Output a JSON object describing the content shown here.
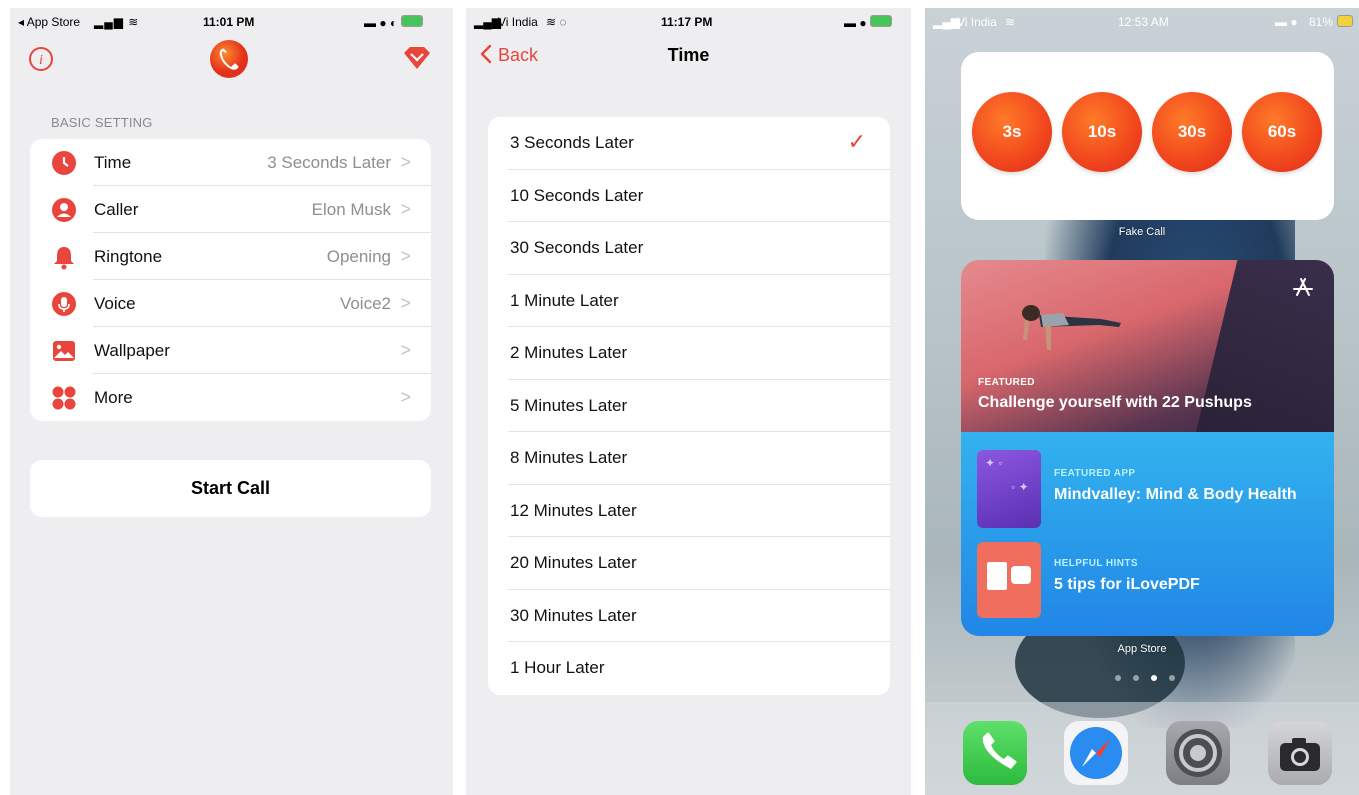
{
  "screen1": {
    "status": {
      "carrier": "◂ App Store",
      "time": "11:01 PM"
    },
    "header": {
      "info_icon": "info-icon",
      "logo_icon": "phone-icon",
      "premium_icon": "gem-icon"
    },
    "section_label": "BASIC SETTING",
    "settings": [
      {
        "label": "Time",
        "value": "3 Seconds Later",
        "icon": "clock-icon"
      },
      {
        "label": "Caller",
        "value": "Elon Musk",
        "icon": "person-icon"
      },
      {
        "label": "Ringtone",
        "value": "Opening",
        "icon": "bell-icon"
      },
      {
        "label": "Voice",
        "value": "Voice2",
        "icon": "microphone-icon"
      },
      {
        "label": "Wallpaper",
        "value": "",
        "icon": "image-icon"
      },
      {
        "label": "More",
        "value": "",
        "icon": "grid-icon"
      }
    ],
    "chevron": ">",
    "start_button": "Start Call",
    "accent": "#e9453c"
  },
  "screen2": {
    "status": {
      "carrier": "Vi India",
      "time": "11:17 PM"
    },
    "nav": {
      "back": "Back",
      "title": "Time"
    },
    "selected_index": 0,
    "options": [
      "3 Seconds Later",
      "10 Seconds Later",
      "30 Seconds Later",
      "1 Minute Later",
      "2 Minutes Later",
      "5 Minutes Later",
      "8 Minutes Later",
      "12 Minutes Later",
      "20 Minutes Later",
      "30 Minutes Later",
      "1 Hour Later"
    ],
    "check_mark": "✓"
  },
  "screen3": {
    "status": {
      "carrier": "Vi India",
      "time": "12:53 AM",
      "battery": "81%"
    },
    "timer_widget": {
      "buttons": [
        "3s",
        "10s",
        "30s",
        "60s"
      ],
      "caption": "Fake Call"
    },
    "appstore_widget": {
      "featured_label": "FEATURED",
      "featured_title": "Challenge yourself with 22 Pushups",
      "items": [
        {
          "label": "FEATURED APP",
          "title": "Mindvalley: Mind & Body Health"
        },
        {
          "label": "HELPFUL HINTS",
          "title": "5 tips for iLovePDF"
        }
      ],
      "caption": "App Store"
    },
    "dock": [
      "phone-app-icon",
      "safari-icon",
      "settings-icon",
      "camera-icon"
    ]
  }
}
